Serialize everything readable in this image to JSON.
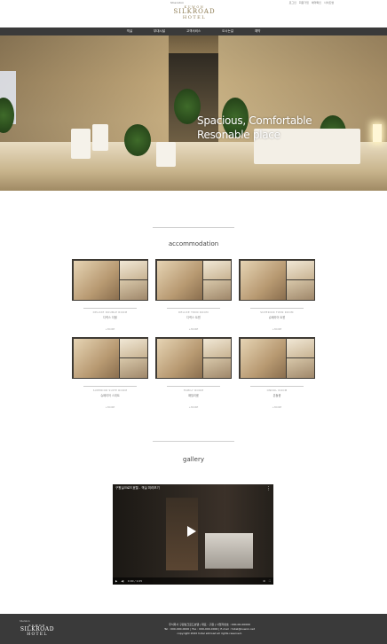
{
  "header": {
    "small_label": "Sheraton",
    "logo": {
      "line1": "KUWON",
      "line2": "SILKROAD",
      "line3": "HOTEL"
    },
    "util_links": [
      "로그인",
      "회원가입",
      "예약확인",
      "사이트맵"
    ]
  },
  "nav": [
    "객실",
    "부대시설",
    "고객서비스",
    "오시는길",
    "예약"
  ],
  "hero": {
    "line1": "Spacious, Comfortable",
    "line2": "Resonable place"
  },
  "accommodation": {
    "title": "accommodation",
    "rooms": [
      {
        "en": "DELUXE DOUBLE ROOM",
        "ko": "디럭스 더블",
        "more": "+MORE"
      },
      {
        "en": "DELUXE TWIN ROOM",
        "ko": "디럭스 트윈",
        "more": "+MORE"
      },
      {
        "en": "SUPERIOR TWIN ROOM",
        "ko": "슈페리어 트윈",
        "more": "+MORE"
      },
      {
        "en": "SUPERIOR SUITE ROOM",
        "ko": "슈페리어 스위트",
        "more": "+MORE"
      },
      {
        "en": "FAMILY ROOM",
        "ko": "패밀리룸",
        "more": "+MORE"
      },
      {
        "en": "ONDOL ROOM",
        "ko": "온돌룸",
        "more": "+MORE"
      }
    ]
  },
  "gallery": {
    "title": "gallery",
    "video_title": "구원실크로드호텔 - 객실 미리보기",
    "time": "0:00 / 1:05"
  },
  "footer": {
    "small": "Sheraton",
    "logo": {
      "line1": "KUWON",
      "line2": "SILKROAD",
      "line3": "HOTEL"
    },
    "line1": "주식회사 구원실크로드호텔 | 대표 : 구원 | 사업자번호 : 000-00-00000",
    "line2": "Tel : 000-000-0000 | Fax : 000-000-0000 | E-mail : hotel@kuwon.net",
    "line3": "copyright 2020 hotel silkroad all rights reserved."
  }
}
